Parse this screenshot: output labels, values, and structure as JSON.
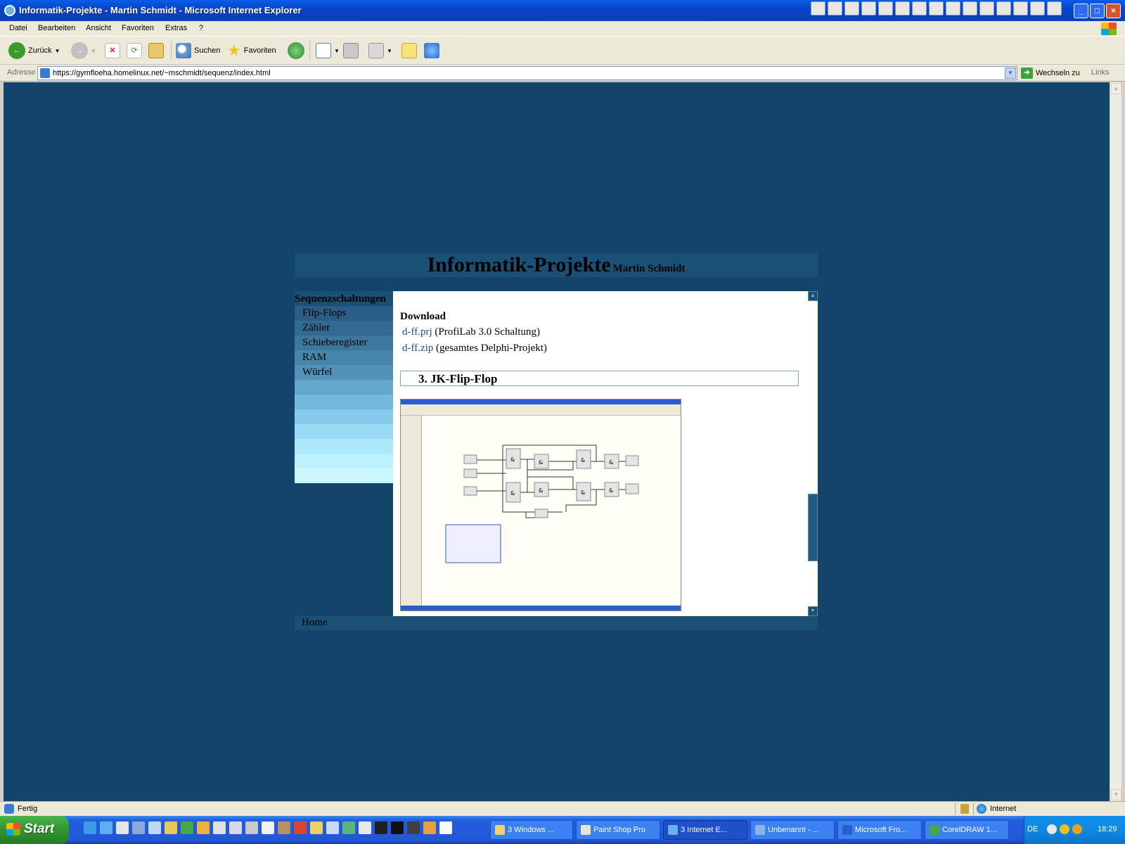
{
  "window": {
    "title": "Informatik-Projekte - Martin Schmidt - Microsoft Internet Explorer"
  },
  "menu": [
    "Datei",
    "Bearbeiten",
    "Ansicht",
    "Favoriten",
    "Extras",
    "?"
  ],
  "toolbar": {
    "back": "Zurück",
    "search": "Suchen",
    "favorites": "Favoriten"
  },
  "address": {
    "label": "Adresse",
    "url": "https://gymfloeha.homelinux.net/~mschmidt/sequenz/index.html",
    "go": "Wechseln zu",
    "links": "Links"
  },
  "site": {
    "title": "Informatik-Projekte",
    "author": "Martin Schmidt",
    "sidebar_heading": "Sequenzschaltungen",
    "nav": [
      "Flip-Flops",
      "Zähler",
      "Schieberegister",
      "RAM",
      "Würfel"
    ],
    "nav_colors": [
      "#2a5e86",
      "#336a92",
      "#3d779e",
      "#4885ab",
      "#5292b8"
    ],
    "fill_colors": [
      "#64a6cc",
      "#74b8dc",
      "#86cae9",
      "#98daf3",
      "#aae8fa",
      "#bcf2fd",
      "#cbf7fe"
    ],
    "download_title": "Download",
    "downloads": [
      {
        "link": "d-ff.prj",
        "desc": "(ProfiLab 3.0 Schaltung)"
      },
      {
        "link": "d-ff.zip",
        "desc": "(gesamtes Delphi-Projekt)"
      }
    ],
    "section_title": "3. JK-Flip-Flop",
    "footer_home": "Home",
    "background": "#134469",
    "header_color": "#1a5075"
  },
  "status": {
    "text": "Fertig",
    "zone": "Internet"
  },
  "taskbar": {
    "start": "Start",
    "tasks": [
      "3 Windows ...",
      "Paint Shop Pro",
      "3 Internet E...",
      "Unbenannt - ...",
      "Microsoft Fro...",
      "CorelDRAW 1..."
    ],
    "lang": "DE",
    "clock": "18:29"
  }
}
